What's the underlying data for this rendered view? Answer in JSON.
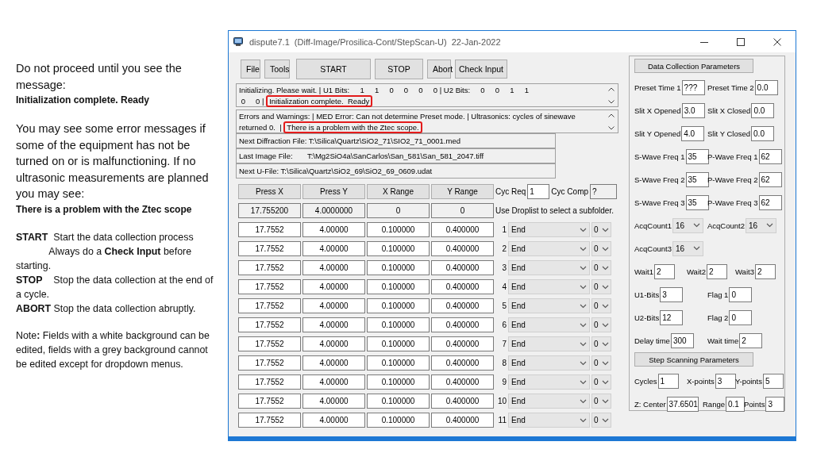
{
  "notes": [
    [
      {
        "kind": "plain",
        "text": "Do not proceed until you see the message:"
      },
      {
        "kind": "bold",
        "text": "Initialization complete. Ready"
      }
    ],
    [
      {
        "kind": "plain",
        "text": "You may see some error messages if some of the equipment has not be turned on or is malfunctioning. If no ultrasonic measurements are planned you may see:"
      },
      {
        "kind": "bold",
        "text": "There is a problem with the Ztec scope"
      }
    ],
    [
      {
        "kind": "rich",
        "text": "**START**  Start the data collection process\n            Always do a **Check Input** before starting."
      },
      {
        "kind": "rich",
        "text": "**STOP**    Stop the data collection at the end of a cycle."
      },
      {
        "kind": "rich",
        "text": "**ABORT** Stop the data collection abruptly."
      }
    ],
    [
      {
        "kind": "rich",
        "text": "Note**:** Fields with a white background can be edited, fields with a grey background cannot be edited except for dropdown menus."
      }
    ]
  ],
  "window": {
    "title": "dispute7.1  (Diff-Image/Prosilica-Cont/StepScan-U)  22-Jan-2022"
  },
  "toolbar": [
    {
      "label": "File",
      "kind": "small"
    },
    {
      "label": "Tools",
      "kind": "small"
    },
    {
      "label": "START",
      "kind": "wide"
    },
    {
      "label": "STOP",
      "kind": "wide"
    },
    {
      "label": "Abort",
      "kind": "small"
    },
    {
      "label": "Check Input",
      "kind": "small"
    }
  ],
  "logs": [
    {
      "lines": [
        [
          {
            "text": "Initializing. Please wait. | U1 Bits:     1     1     0     0     0     0 | U2 Bits:     0     0     1     1",
            "highlighted": false
          }
        ],
        [
          {
            "text": " 0     0 | ",
            "highlighted": false
          },
          {
            "text": "Initialization complete.  Ready",
            "highlighted": true
          }
        ]
      ]
    },
    {
      "lines": [
        [
          {
            "text": "Errors and Warnings: | MED Error: Can not determine Preset mode. | Ultrasonics: cycles of sinewave",
            "highlighted": false
          }
        ],
        [
          {
            "text": "returned 0.  | ",
            "highlighted": false
          },
          {
            "text": "There is a problem with the Ztec scope.",
            "highlighted": true
          }
        ]
      ]
    }
  ],
  "files": [
    "Next Diffraction File: T:\\Silica\\Quartz\\SiO2_71\\SIO2_71_0001.med",
    "Last Image File:       T:\\Mg2SiO4a\\SanCarlos\\San_581\\San_581_2047.tiff",
    "Next U-File: T:\\Silica\\Quartz\\SiO2_69\\SiO2_69_0609.udat"
  ],
  "grid": {
    "columns": [
      "Press X",
      "Press Y",
      "X Range",
      "Y Range"
    ],
    "cyc_req": {
      "label": "Cyc Req",
      "value": "1",
      "editable": true
    },
    "cyc_comp": {
      "label": "Cyc Comp",
      "value": "?",
      "editable": false
    },
    "current": [
      "17.755200",
      "4.0000000",
      "0",
      "0"
    ],
    "hint": "Use Droplist to select a subfolder.",
    "rows": [
      {
        "number": "1",
        "values": [
          "17.7552",
          "4.00000",
          "0.100000",
          "0.400000"
        ],
        "folder": "End",
        "count": "0"
      },
      {
        "number": "2",
        "values": [
          "17.7552",
          "4.00000",
          "0.100000",
          "0.400000"
        ],
        "folder": "End",
        "count": "0"
      },
      {
        "number": "3",
        "values": [
          "17.7552",
          "4.00000",
          "0.100000",
          "0.400000"
        ],
        "folder": "End",
        "count": "0"
      },
      {
        "number": "4",
        "values": [
          "17.7552",
          "4.00000",
          "0.100000",
          "0.400000"
        ],
        "folder": "End",
        "count": "0"
      },
      {
        "number": "5",
        "values": [
          "17.7552",
          "4.00000",
          "0.100000",
          "0.400000"
        ],
        "folder": "End",
        "count": "0"
      },
      {
        "number": "6",
        "values": [
          "17.7552",
          "4.00000",
          "0.100000",
          "0.400000"
        ],
        "folder": "End",
        "count": "0"
      },
      {
        "number": "7",
        "values": [
          "17.7552",
          "4.00000",
          "0.100000",
          "0.400000"
        ],
        "folder": "End",
        "count": "0"
      },
      {
        "number": "8",
        "values": [
          "17.7552",
          "4.00000",
          "0.100000",
          "0.400000"
        ],
        "folder": "End",
        "count": "0"
      },
      {
        "number": "9",
        "values": [
          "17.7552",
          "4.00000",
          "0.100000",
          "0.400000"
        ],
        "folder": "End",
        "count": "0"
      },
      {
        "number": "10",
        "values": [
          "17.7552",
          "4.00000",
          "0.100000",
          "0.400000"
        ],
        "folder": "End",
        "count": "0"
      },
      {
        "number": "11",
        "values": [
          "17.7552",
          "4.00000",
          "0.100000",
          "0.400000"
        ],
        "folder": "End",
        "count": "0"
      }
    ]
  },
  "params": [
    {
      "header": "Data Collection Parameters",
      "rows": [
        [
          {
            "kind": "field",
            "label": "Preset Time 1",
            "value": "???"
          },
          {
            "kind": "field",
            "label": "Preset Time 2",
            "value": "0.0"
          }
        ],
        [
          {
            "kind": "field",
            "label": "Slit X Opened",
            "value": "3.0"
          },
          {
            "kind": "field",
            "label": "Slit X Closed",
            "value": "0.0"
          }
        ],
        [
          {
            "kind": "field",
            "label": "Slit Y Opened",
            "value": "4.0"
          },
          {
            "kind": "field",
            "label": "Slit Y Closed",
            "value": "0.0"
          }
        ],
        [
          {
            "kind": "field",
            "label": "S-Wave Freq 1",
            "value": "35"
          },
          {
            "kind": "field",
            "label": "P-Wave Freq 1",
            "value": "62"
          }
        ],
        [
          {
            "kind": "field",
            "label": "S-Wave Freq 2",
            "value": "35"
          },
          {
            "kind": "field",
            "label": "P-Wave Freq 2",
            "value": "62"
          }
        ],
        [
          {
            "kind": "field",
            "label": "S-Wave Freq 3",
            "value": "35"
          },
          {
            "kind": "field",
            "label": "P-Wave Freq 3",
            "value": "62"
          }
        ],
        [
          {
            "kind": "select",
            "label": "AcqCount1",
            "value": "16"
          },
          {
            "kind": "select",
            "label": "AcqCount2",
            "value": "16"
          }
        ],
        [
          {
            "kind": "select",
            "label": "AcqCount3",
            "value": "16"
          }
        ],
        [
          {
            "kind": "field",
            "label": "Wait1",
            "value": "2"
          },
          {
            "kind": "field",
            "label": "Wait2",
            "value": "2"
          },
          {
            "kind": "field",
            "label": "Wait3",
            "value": "2"
          }
        ],
        [
          {
            "kind": "field",
            "label": "U1-Bits",
            "value": "3"
          },
          {
            "kind": "field",
            "label": "Flag 1",
            "value": "0"
          }
        ],
        [
          {
            "kind": "field",
            "label": "U2-Bits",
            "value": "12"
          },
          {
            "kind": "field",
            "label": "Flag 2",
            "value": "0"
          }
        ],
        [
          {
            "kind": "field",
            "label": "Delay time",
            "value": "300"
          },
          {
            "kind": "field",
            "label": "Wait time",
            "value": "2"
          }
        ]
      ]
    },
    {
      "header": "Step Scanning Parameters",
      "rows": [
        [
          {
            "kind": "field",
            "label": "Cycles",
            "value": "1"
          },
          {
            "kind": "field",
            "label": "X-points",
            "value": "3"
          },
          {
            "kind": "field",
            "label": "Y-points",
            "value": "5"
          }
        ],
        [
          {
            "kind": "field",
            "label": "Z: Center",
            "value": "37.6501"
          },
          {
            "kind": "field",
            "label": "Range",
            "value": "0.1"
          },
          {
            "kind": "field",
            "label": "Points",
            "value": "3"
          }
        ]
      ]
    }
  ]
}
